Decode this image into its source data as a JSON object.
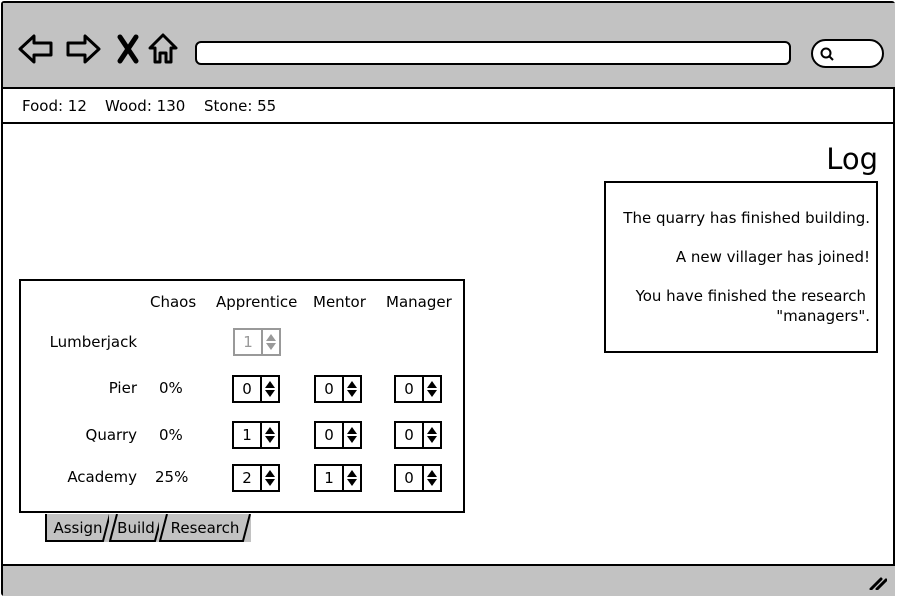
{
  "resources": {
    "food": "Food: 12",
    "wood": "Wood: 130",
    "stone": "Stone: 55"
  },
  "icons": {
    "back": "back-arrow-icon",
    "forward": "forward-arrow-icon",
    "stop": "close-icon",
    "home": "home-icon",
    "search": "search-icon",
    "resize": "resize-grip-icon"
  },
  "log": {
    "title": "Log",
    "lines": [
      "The quarry has finished building.",
      "A new villager has joined!",
      "You have finished the research",
      "\"managers\"."
    ]
  },
  "assign": {
    "headers": [
      "Chaos",
      "Apprentice",
      "Mentor",
      "Manager"
    ],
    "rows": [
      {
        "label": "Lumberjack",
        "chaos": "",
        "apprentice": "1",
        "mentor": "",
        "manager": ""
      },
      {
        "label": "Pier",
        "chaos": "0%",
        "apprentice": "0",
        "mentor": "0",
        "manager": "0"
      },
      {
        "label": "Quarry",
        "chaos": "0%",
        "apprentice": "1",
        "mentor": "0",
        "manager": "0"
      },
      {
        "label": "Academy",
        "chaos": "25%",
        "apprentice": "2",
        "mentor": "1",
        "manager": "0"
      }
    ]
  },
  "tabs": [
    "Assign",
    "Build",
    "Research"
  ],
  "colors": {
    "chrome": "#c2c2c2",
    "disabled": "#999999"
  }
}
